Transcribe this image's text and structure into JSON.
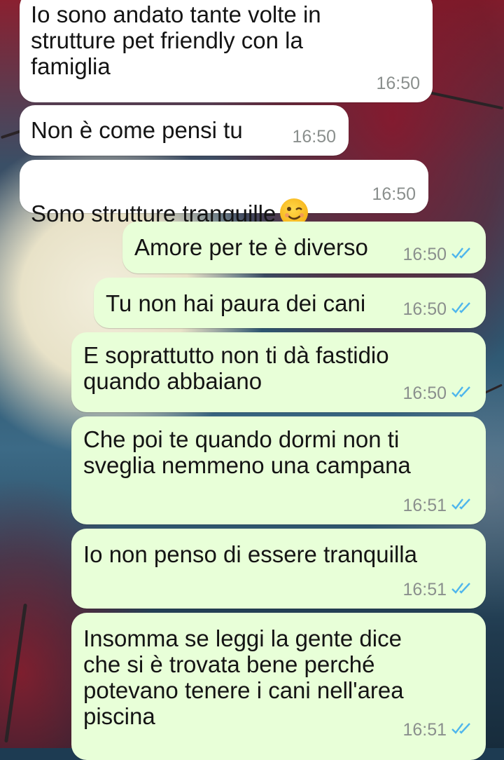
{
  "messages": [
    {
      "dir": "in",
      "text": "Io sono andato tante volte in\nstrutture pet friendly con la\nfamiglia",
      "time": "16:50"
    },
    {
      "dir": "in",
      "text": "Non è come pensi tu",
      "time": "16:50"
    },
    {
      "dir": "in",
      "text": "Sono strutture tranquille",
      "emoji": "wink-face",
      "time": "16:50"
    },
    {
      "dir": "out",
      "text": "Amore per te è diverso",
      "time": "16:50",
      "status": "read"
    },
    {
      "dir": "out",
      "text": "Tu non hai paura dei cani",
      "time": "16:50",
      "status": "read"
    },
    {
      "dir": "out",
      "text": "E soprattutto non ti dà fastidio\nquando abbaiano",
      "time": "16:50",
      "status": "read"
    },
    {
      "dir": "out",
      "text": "Che poi te quando dormi non ti\nsveglia nemmeno una campana",
      "time": "16:51",
      "status": "read"
    },
    {
      "dir": "out",
      "text": "Io non penso di essere tranquilla",
      "time": "16:51",
      "status": "read"
    },
    {
      "dir": "out",
      "text": "Insomma se leggi la gente dice\nche si è trovata bene perché\npotevano tenere i cani nell'area\npiscina",
      "time": "16:51",
      "status": "read"
    }
  ],
  "colors": {
    "incoming_bubble": "#ffffff",
    "outgoing_bubble": "#e8ffd8",
    "timestamp": "#8a8f8d",
    "read_ticks": "#4fb6ec"
  }
}
